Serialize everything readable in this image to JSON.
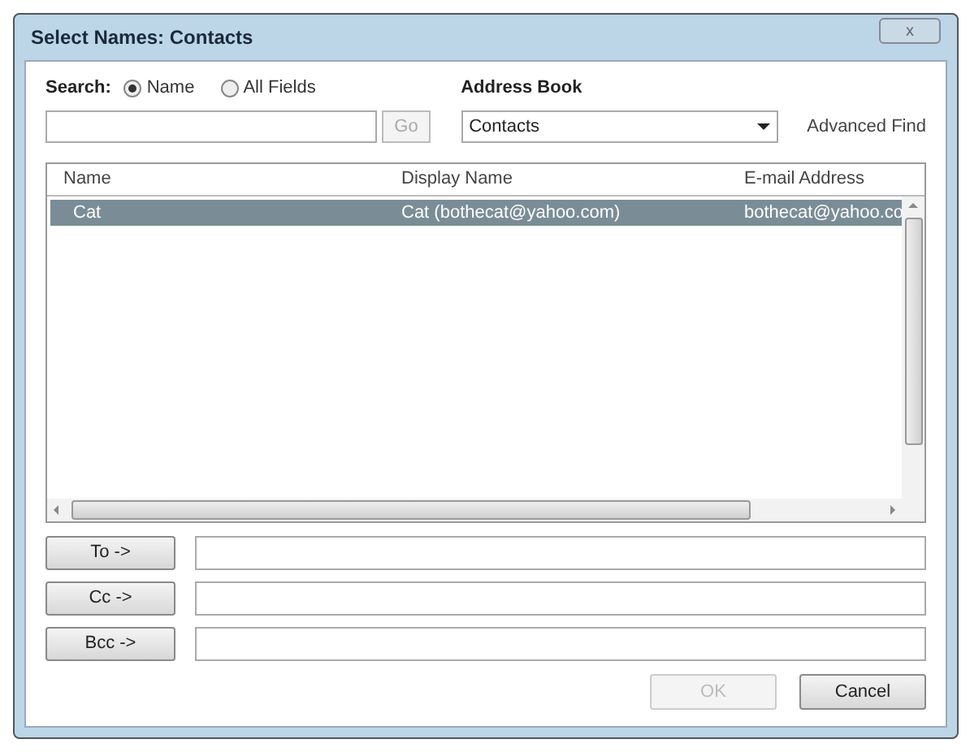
{
  "window": {
    "title": "Select Names: Contacts",
    "close": "x"
  },
  "search": {
    "label": "Search:",
    "options": [
      {
        "label": "Name",
        "selected": true
      },
      {
        "label": "All Fields",
        "selected": false
      }
    ],
    "go": {
      "label": "Go",
      "disabled": true
    }
  },
  "address_book": {
    "label": "Address Book",
    "value": "Contacts",
    "advanced_find": "Advanced Find"
  },
  "table": {
    "columns": [
      "Name",
      "Display Name",
      "E-mail Address"
    ],
    "rows": [
      {
        "cells": [
          "Cat",
          "Cat (bothecat@yahoo.com)",
          "bothecat@yahoo.co"
        ],
        "selected": true
      }
    ]
  },
  "recipients": [
    {
      "label": "To ->"
    },
    {
      "label": "Cc ->"
    },
    {
      "label": "Bcc ->"
    }
  ],
  "buttons": [
    {
      "label": "OK",
      "disabled": true
    },
    {
      "label": "Cancel",
      "disabled": false
    }
  ]
}
